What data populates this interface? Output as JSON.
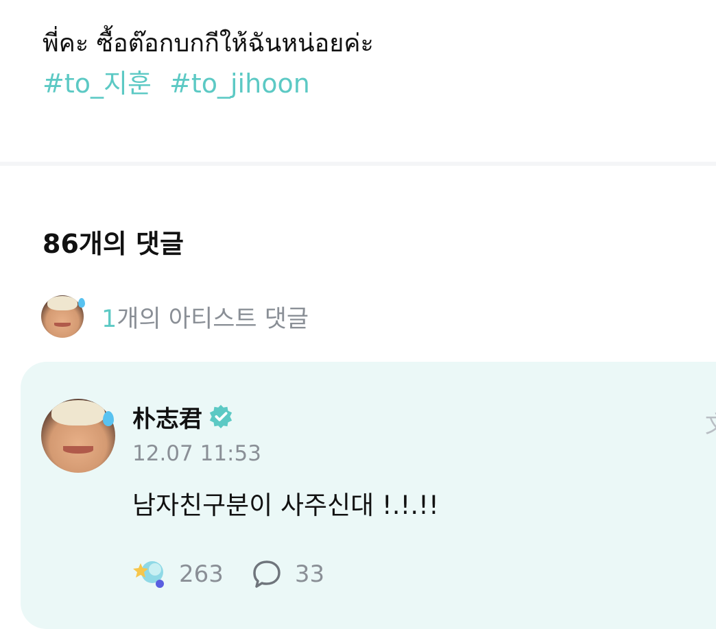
{
  "post": {
    "text": "พี่คะ ซื้อต๊อกบกกีให้ฉันหน่อยค่ะ",
    "hashtags": [
      "#to_지훈",
      "#to_jihoon"
    ]
  },
  "comments": {
    "title": "86개의 댓글",
    "artist_summary": {
      "count": "1",
      "label": "개의 아티스트 댓글"
    }
  },
  "artist_comment": {
    "author": "朴志君",
    "timestamp": "12.07 11:53",
    "body": "남자친구분이 사주신대 !.!.!!",
    "likes": "263",
    "replies": "33",
    "translate_glyph": "文"
  },
  "colors": {
    "accent": "#5cc9c4",
    "card_bg": "#ebf8f7",
    "muted_text": "#8a8f96"
  },
  "icons": {
    "verified": "verified-badge-icon",
    "like": "star-heart-like-icon",
    "reply": "speech-bubble-icon",
    "translate": "translate-icon"
  }
}
